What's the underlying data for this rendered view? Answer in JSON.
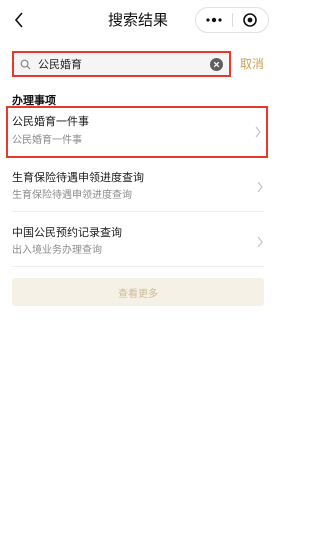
{
  "navbar": {
    "title": "搜索结果",
    "back_icon": "chevron-left-icon",
    "more_icon": "more-dots-icon",
    "close_icon": "target-close-icon"
  },
  "search": {
    "value": "公民婚育",
    "placeholder": "",
    "cancel_label": "取消"
  },
  "section": {
    "title": "办理事项"
  },
  "results": [
    {
      "title": "公民婚育一件事",
      "subtitle": "公民婚育一件事"
    },
    {
      "title": "生育保险待遇申领进度查询",
      "subtitle": "生育保险待遇申领进度查询"
    },
    {
      "title": "中国公民预约记录查询",
      "subtitle": "出入境业务办理查询"
    }
  ],
  "more_button": {
    "label": "查看更多"
  },
  "colors": {
    "accent": "#c8a15a",
    "highlight": "#e7392b"
  }
}
